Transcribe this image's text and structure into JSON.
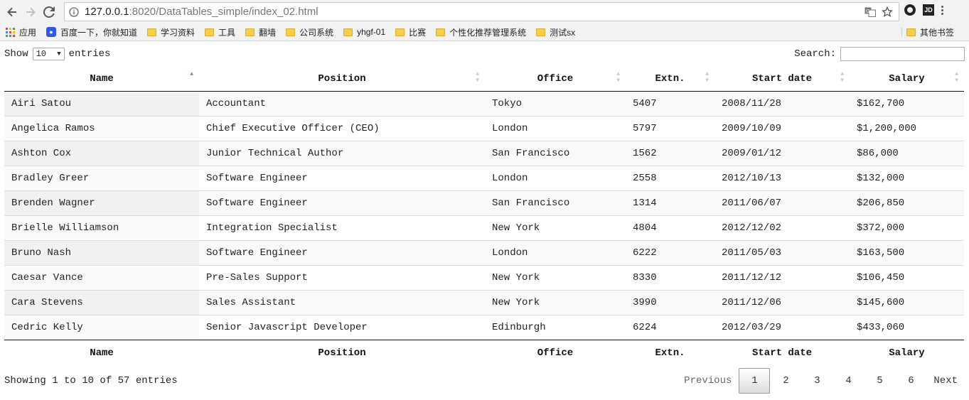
{
  "browser": {
    "url_host": "127.0.0.1",
    "url_path": ":8020/DataTables_simple/index_02.html",
    "bookmarks": [
      "应用",
      "百度一下，你就知道",
      "学习资料",
      "工具",
      "翻墙",
      "公司系统",
      "yhgf-01",
      "比赛",
      "个性化推荐管理系统",
      "测试sx"
    ],
    "other_bookmarks": "其他书签"
  },
  "controls": {
    "show_label": "Show",
    "length_value": "10",
    "entries_label": "entries",
    "search_label": "Search:",
    "search_value": ""
  },
  "table": {
    "columns": [
      "Name",
      "Position",
      "Office",
      "Extn.",
      "Start date",
      "Salary"
    ],
    "rows": [
      [
        "Airi Satou",
        "Accountant",
        "Tokyo",
        "5407",
        "2008/11/28",
        "$162,700"
      ],
      [
        "Angelica Ramos",
        "Chief Executive Officer (CEO)",
        "London",
        "5797",
        "2009/10/09",
        "$1,200,000"
      ],
      [
        "Ashton Cox",
        "Junior Technical Author",
        "San Francisco",
        "1562",
        "2009/01/12",
        "$86,000"
      ],
      [
        "Bradley Greer",
        "Software Engineer",
        "London",
        "2558",
        "2012/10/13",
        "$132,000"
      ],
      [
        "Brenden Wagner",
        "Software Engineer",
        "San Francisco",
        "1314",
        "2011/06/07",
        "$206,850"
      ],
      [
        "Brielle Williamson",
        "Integration Specialist",
        "New York",
        "4804",
        "2012/12/02",
        "$372,000"
      ],
      [
        "Bruno Nash",
        "Software Engineer",
        "London",
        "6222",
        "2011/05/03",
        "$163,500"
      ],
      [
        "Caesar Vance",
        "Pre-Sales Support",
        "New York",
        "8330",
        "2011/12/12",
        "$106,450"
      ],
      [
        "Cara Stevens",
        "Sales Assistant",
        "New York",
        "3990",
        "2011/12/06",
        "$145,600"
      ],
      [
        "Cedric Kelly",
        "Senior Javascript Developer",
        "Edinburgh",
        "6224",
        "2012/03/29",
        "$433,060"
      ]
    ]
  },
  "footer": {
    "info": "Showing 1 to 10 of 57 entries",
    "previous": "Previous",
    "next": "Next",
    "pages": [
      "1",
      "2",
      "3",
      "4",
      "5",
      "6"
    ],
    "current_page": "1"
  },
  "colors": {
    "sort_active": "#6c86c9",
    "sort_inactive": "#c6c6c6",
    "folder": "#f6cf4a"
  },
  "icons": {
    "back": "back-arrow-icon",
    "forward": "forward-arrow-icon",
    "reload": "reload-icon",
    "info": "page-info-icon",
    "translate": "translate-icon",
    "star": "bookmark-star-icon",
    "apps": "apps-grid-icon",
    "folder": "folder-icon"
  }
}
